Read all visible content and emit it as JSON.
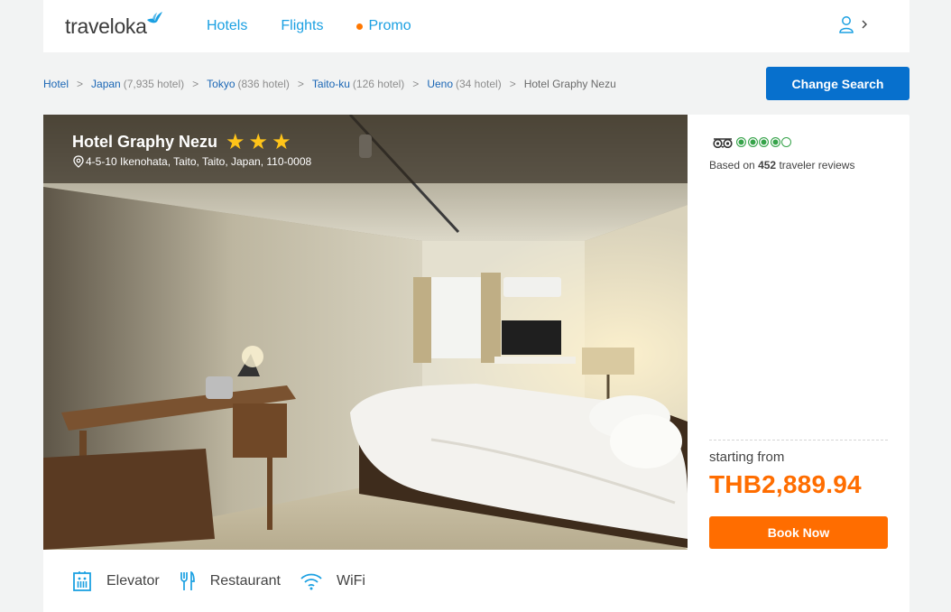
{
  "header": {
    "logo_text": "traveloka",
    "nav": [
      {
        "label": "Hotels"
      },
      {
        "label": "Flights"
      },
      {
        "label": "Promo"
      }
    ],
    "user_chevron": "›"
  },
  "breadcrumb": {
    "items": [
      {
        "label": "Hotel",
        "count": "",
        "link": true
      },
      {
        "label": "Japan",
        "count": "(7,935 hotel)",
        "link": true
      },
      {
        "label": "Tokyo",
        "count": "(836 hotel)",
        "link": true
      },
      {
        "label": "Taito-ku",
        "count": "(126 hotel)",
        "link": true
      },
      {
        "label": "Ueno",
        "count": "(34 hotel)",
        "link": true
      }
    ],
    "separator": ">",
    "current": "Hotel Graphy Nezu"
  },
  "change_search_label": "Change Search",
  "hotel": {
    "name": "Hotel Graphy Nezu",
    "stars": 3,
    "address": "4-5-10 Ikenohata, Taito, Taito, Japan, 110-0008"
  },
  "rating": {
    "tripadvisor_score": 4,
    "tripadvisor_max": 5,
    "reviews_prefix": "Based on",
    "reviews_count": "452",
    "reviews_suffix": "traveler reviews"
  },
  "pricing": {
    "starting_from": "starting from",
    "price": "THB2,889.94",
    "book_label": "Book Now"
  },
  "facilities": [
    {
      "icon": "elevator-icon",
      "label": "Elevator"
    },
    {
      "icon": "restaurant-icon",
      "label": "Restaurant"
    },
    {
      "icon": "wifi-icon",
      "label": "WiFi"
    }
  ],
  "colors": {
    "brand_blue": "#1ba0e2",
    "button_blue": "#0770cd",
    "accent_orange": "#ff6d00",
    "star_yellow": "#ffc419",
    "tripadvisor_green": "#36a34a"
  }
}
